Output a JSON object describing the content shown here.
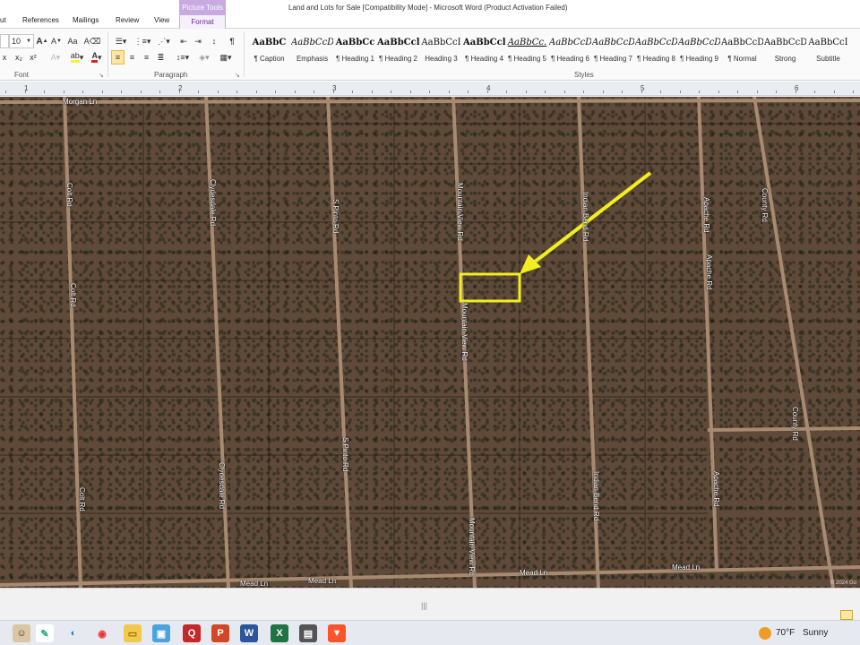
{
  "window": {
    "title": "Land and Lots for Sale [Compatibility Mode]  -  Microsoft Word (Product Activation Failed)"
  },
  "tabs": [
    {
      "label": "ut"
    },
    {
      "label": "References"
    },
    {
      "label": "Mailings"
    },
    {
      "label": "Review"
    },
    {
      "label": "View"
    }
  ],
  "context_tab": {
    "group": "Picture Tools",
    "label": "Format"
  },
  "ribbon": {
    "font_size": "10",
    "groups": {
      "font": "Font",
      "paragraph": "Paragraph",
      "styles": "Styles"
    },
    "paragraph_mark": "¶"
  },
  "styles": [
    {
      "preview": "AaBbC",
      "name": "¶ Caption"
    },
    {
      "preview": "AaBbCcDc",
      "name": "Emphasis"
    },
    {
      "preview": "AaBbCc",
      "name": "¶ Heading 1"
    },
    {
      "preview": "AaBbCcl",
      "name": "¶ Heading 2"
    },
    {
      "preview": "AaBbCcI",
      "name": "Heading 3"
    },
    {
      "preview": "AaBbCcl",
      "name": "¶ Heading 4"
    },
    {
      "preview": "AaBbCc.",
      "name": "¶ Heading 5"
    },
    {
      "preview": "AaBbCcDc",
      "name": "¶ Heading 6"
    },
    {
      "preview": "AaBbCcDc",
      "name": "¶ Heading 7"
    },
    {
      "preview": "AaBbCcDc",
      "name": "¶ Heading 8"
    },
    {
      "preview": "AaBbCcDc",
      "name": "¶ Heading 9"
    },
    {
      "preview": "AaBbCcDc",
      "name": "¶ Normal"
    },
    {
      "preview": "AaBbCcDd",
      "name": "Strong"
    },
    {
      "preview": "AaBbCcI",
      "name": "Subtitle"
    }
  ],
  "ruler": {
    "numbers": [
      "1",
      "2",
      "3",
      "4",
      "5",
      "6"
    ]
  },
  "map": {
    "roads": {
      "morgan": "Morgan Ln",
      "colt_top": "Colt Rd",
      "colt_mid": "Colt Rd",
      "colt_bottom": "Colt Rd",
      "clydesdale_top": "Clydesdale Rd",
      "clydesdale_bottom": "Clydesdale Rd",
      "pinto_top": "S Pinto Rd",
      "pinto_bottom": "S Pinto Rd",
      "mountain_top": "Mountain View Rd",
      "mountain_mid": "Mountain View Rd",
      "mountain_bottom": "Mountain View Rd",
      "indian_top": "Indian Bend Rd",
      "indian_bottom": "Indian Bend Rd",
      "apache_top": "Apache Rd",
      "apache_mid": "Apache Rd",
      "apache_bottom": "Apache Rd",
      "county_top": "County Rd",
      "county_bottom": "County Rd",
      "mead_1": "Mead Ln",
      "mead_2": "Mead Ln",
      "mead_3": "Mead Ln",
      "mead_4": "Mead Ln"
    },
    "highlight_color": "#f2ee1f",
    "copyright": "© 2024 Go"
  },
  "taskbar": {
    "weather_temp": "70°F",
    "weather_cond": "Sunny"
  }
}
